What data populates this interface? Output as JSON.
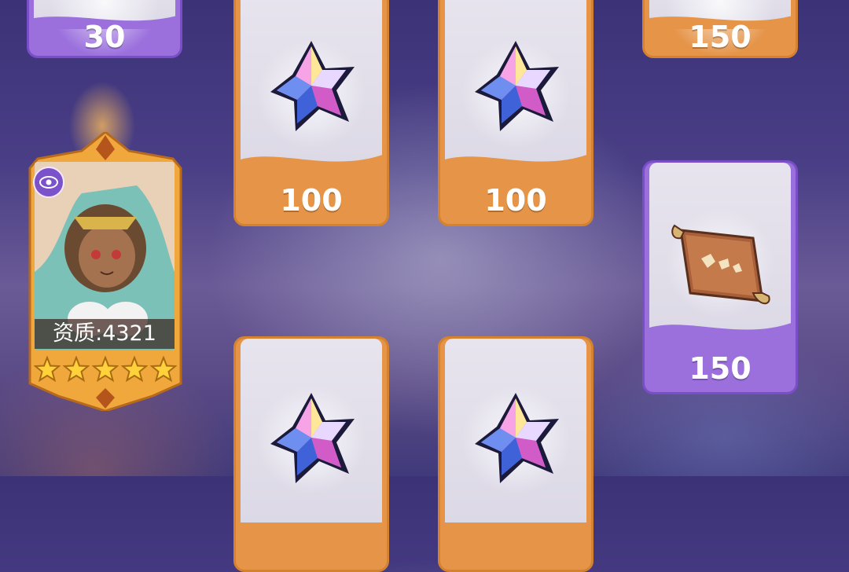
{
  "hero": {
    "quality_text": "资质:4321",
    "stars": 5,
    "faction_icon": "eye-icon"
  },
  "rewards": [
    {
      "item": "crystal-partial-top-left",
      "amount": "30",
      "style": "purple"
    },
    {
      "item": "crystal-star-gem",
      "amount": "100",
      "style": "orange"
    },
    {
      "item": "crystal-star-gem",
      "amount": "100",
      "style": "orange"
    },
    {
      "item": "partial-top-right",
      "amount": "150",
      "style": "orange"
    },
    {
      "item": "scroll",
      "amount": "150",
      "style": "purple"
    },
    {
      "item": "crystal-star-gem",
      "amount": "",
      "style": "orange"
    },
    {
      "item": "crystal-star-gem",
      "amount": "",
      "style": "orange"
    }
  ],
  "colors": {
    "orange_card": "#e59448",
    "purple_card": "#9b70dd",
    "background": "#4a3f86"
  }
}
